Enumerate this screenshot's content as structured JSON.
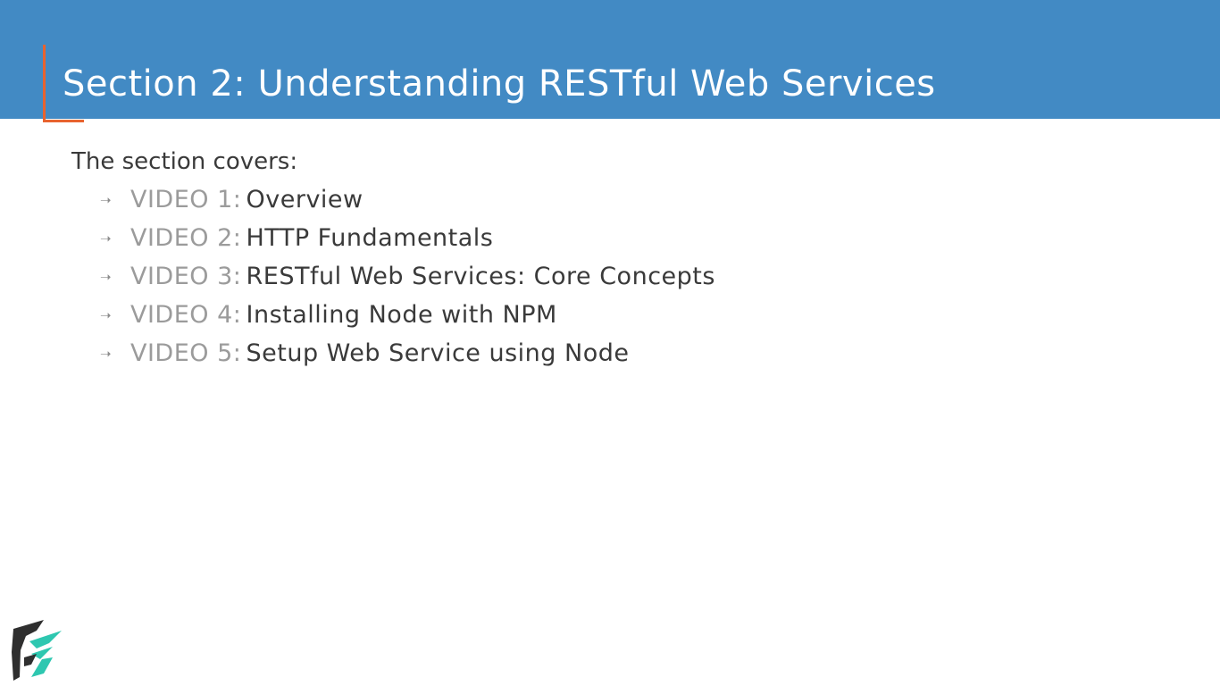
{
  "slide": {
    "title": "Section 2: Understanding RESTful Web Services",
    "intro": "The section covers:",
    "bullet_icon": "arrow-right-icon",
    "items": [
      {
        "prefix": "VIDEO 1:",
        "title": "Overview"
      },
      {
        "prefix": "VIDEO 2:",
        "title": "HTTP Fundamentals"
      },
      {
        "prefix": "VIDEO 3:",
        "title": "RESTful Web Services: Core Concepts"
      },
      {
        "prefix": "VIDEO 4:",
        "title": "Installing Node with NPM"
      },
      {
        "prefix": "VIDEO 5:",
        "title": "Setup Web Service using Node"
      }
    ]
  },
  "colors": {
    "header_bg": "#428ac4",
    "accent": "#e8632f",
    "prefix_text": "#9b9b9b",
    "body_text": "#3a3a3a",
    "logo_dark": "#2f2f2f",
    "logo_teal": "#2ec7b0"
  },
  "logo": {
    "icon": "brand-logo-icon"
  }
}
